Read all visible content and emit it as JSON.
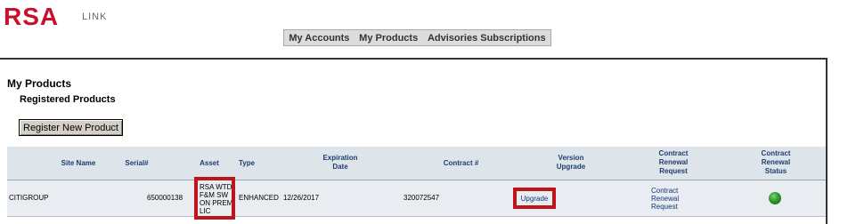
{
  "logo": {
    "brand": "RSA",
    "sub": "LINK"
  },
  "nav": {
    "accounts": "My Accounts",
    "products": "My Products",
    "advisories": "Advisories Subscriptions"
  },
  "page": {
    "title": "My Products",
    "subtitle": "Registered Products",
    "register_button": "Register New Product"
  },
  "table": {
    "headers": {
      "site": "Site Name",
      "serial": "Serial#",
      "asset": "Asset",
      "type": "Type",
      "expiration": "Expiration Date",
      "contract": "Contract #",
      "version": "Version Upgrade",
      "renewal_request": "Contract Renewal Request",
      "renewal_status": "Contract Renewal Status"
    },
    "rows": [
      {
        "site": "CITIGROUP",
        "serial": "650000138",
        "asset": "RSA WTD F&M SW ON PREM LIC",
        "type": "ENHANCED",
        "expiration": "12/26/2017",
        "contract": "320072547",
        "upgrade": "Upgrade",
        "renewal_request": "Contract Renewal Request",
        "renewal_status_icon": "green-status-icon"
      }
    ]
  },
  "colors": {
    "brand": "#c8102e",
    "highlight": "#c0141b",
    "header_text": "#1f3e6e",
    "status": "#2e9a2e"
  }
}
